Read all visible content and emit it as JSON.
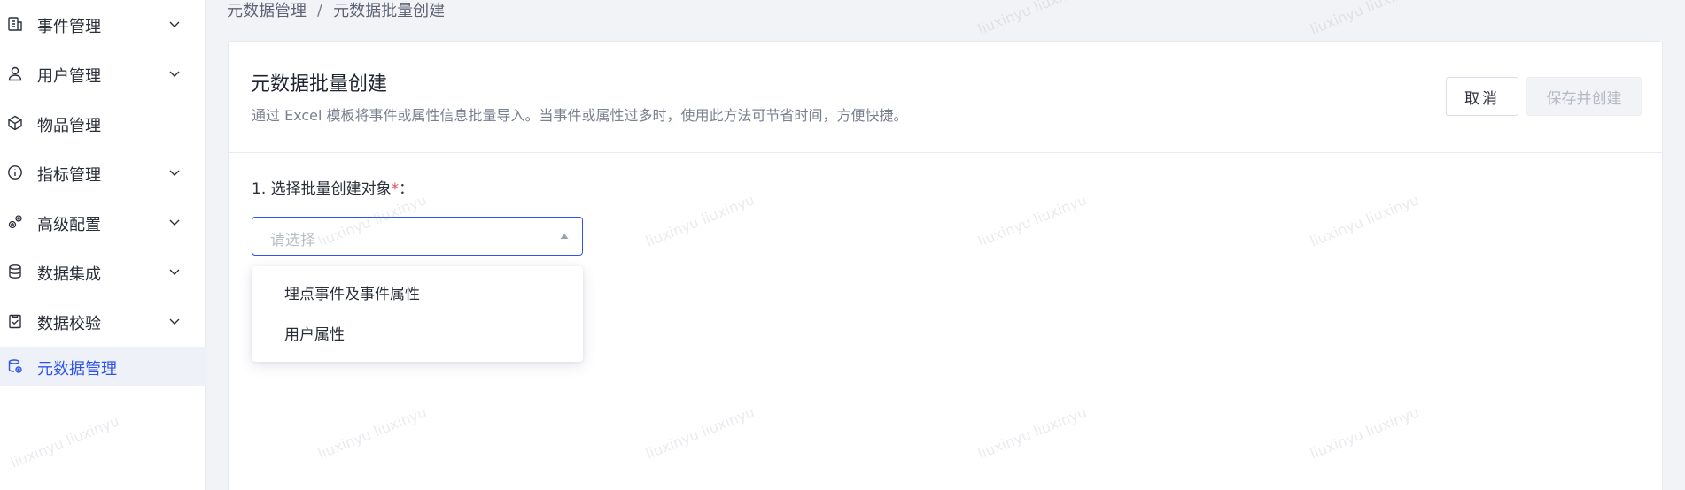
{
  "sidebar": {
    "items": [
      {
        "label": "事件管理",
        "icon": "document-chart-icon",
        "has_chevron": true
      },
      {
        "label": "用户管理",
        "icon": "user-icon",
        "has_chevron": true
      },
      {
        "label": "物品管理",
        "icon": "cube-icon",
        "has_chevron": false
      },
      {
        "label": "指标管理",
        "icon": "metric-info-icon",
        "has_chevron": true
      },
      {
        "label": "高级配置",
        "icon": "gears-icon",
        "has_chevron": true
      },
      {
        "label": "数据集成",
        "icon": "database-icon",
        "has_chevron": true
      },
      {
        "label": "数据校验",
        "icon": "clipboard-check-icon",
        "has_chevron": true
      },
      {
        "label": "元数据管理",
        "icon": "metadata-gear-icon",
        "has_chevron": false,
        "active": true
      }
    ]
  },
  "breadcrumb": {
    "items": [
      "元数据管理",
      "元数据批量创建"
    ],
    "separator": "/"
  },
  "page": {
    "title": "元数据批量创建",
    "description": "通过 Excel 模板将事件或属性信息批量导入。当事件或属性过多时，使用此方法可节省时间，方便快捷。"
  },
  "actions": {
    "cancel_label": "取消",
    "save_label": "保存并创建"
  },
  "form": {
    "step_label": "1. 选择批量创建对象",
    "required_mark": "*",
    "label_suffix": "：",
    "select_placeholder": "请选择",
    "options": [
      "埋点事件及事件属性",
      "用户属性"
    ]
  },
  "watermark_text": "liuxinyu liuxinyu",
  "colors": {
    "accent": "#2f54eb",
    "required": "#e34d59",
    "sidebar_active_bg": "#eef1f7",
    "page_bg": "#f1f3f7"
  }
}
